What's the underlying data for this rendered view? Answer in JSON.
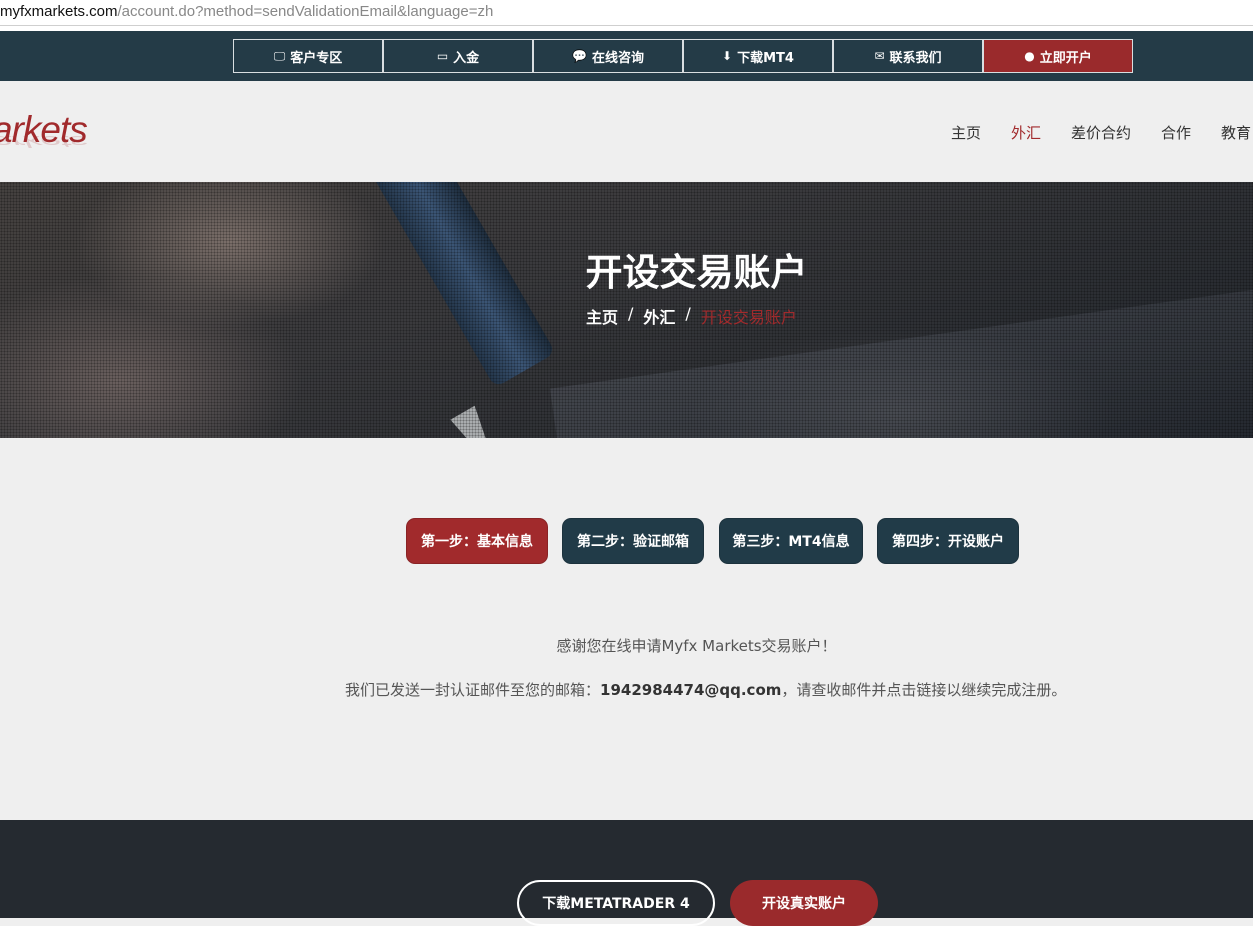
{
  "browser": {
    "url_host": "myfxmarkets.com",
    "url_path": "/account.do?method=sendValidationEmail&language=zh"
  },
  "topbar": {
    "items": [
      {
        "label": "客户专区",
        "icon": "monitor-icon",
        "glyph": "🖵"
      },
      {
        "label": "入金",
        "icon": "credit-card-icon",
        "glyph": "▭"
      },
      {
        "label": "在线咨询",
        "icon": "chat-icon",
        "glyph": "💬"
      },
      {
        "label": "下载MT4",
        "icon": "download-icon",
        "glyph": "⬇"
      },
      {
        "label": "联系我们",
        "icon": "envelope-icon",
        "glyph": "✉"
      },
      {
        "label": "立即开户",
        "icon": "globe-icon",
        "glyph": "●"
      }
    ]
  },
  "header": {
    "logo_text": "arkets",
    "nav": [
      "主页",
      "外汇",
      "差价合约",
      "合作",
      "教育"
    ],
    "active_nav": "外汇"
  },
  "hero": {
    "title": "开设交易账户",
    "breadcrumb": {
      "home": "主页",
      "section": "外汇",
      "current": "开设交易账户",
      "separator": "/"
    }
  },
  "steps": [
    {
      "label": "第一步：基本信息",
      "active": true
    },
    {
      "label": "第二步：验证邮箱",
      "active": false
    },
    {
      "label": "第三步：MT4信息",
      "active": false
    },
    {
      "label": "第四步：开设账户",
      "active": false
    }
  ],
  "message": {
    "line1": "感谢您在线申请Myfx Markets交易账户！",
    "line2_prefix": "我们已发送一封认证邮件至您的邮箱：",
    "email": "1942984474@qq.com",
    "line2_suffix": "，请查收邮件并点击链接以继续完成注册。"
  },
  "footer": {
    "download_label": "下载METATRADER 4",
    "open_label": "开设真实账户"
  },
  "colors": {
    "accent": "#a12a2c",
    "dark": "#243b47",
    "footer": "#252a30"
  }
}
